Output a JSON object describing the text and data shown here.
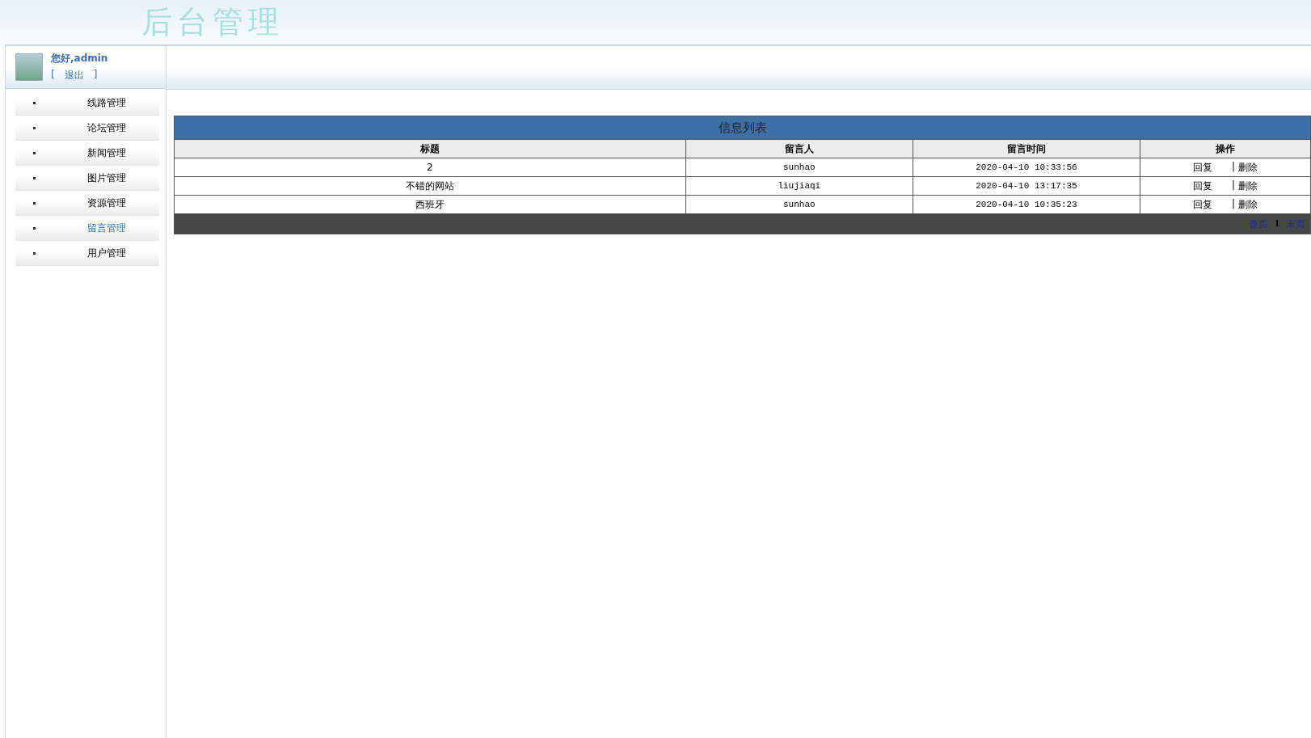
{
  "header": {
    "title": "后台管理"
  },
  "user": {
    "greeting": "您好,admin",
    "logout_open": "[",
    "logout": "退出",
    "logout_close": "]"
  },
  "sidebar": {
    "items": [
      {
        "label": "线路管理",
        "selected": false
      },
      {
        "label": "论坛管理",
        "selected": false
      },
      {
        "label": "新闻管理",
        "selected": false
      },
      {
        "label": "图片管理",
        "selected": false
      },
      {
        "label": "资源管理",
        "selected": false
      },
      {
        "label": "留言管理",
        "selected": true
      },
      {
        "label": "用户管理",
        "selected": false
      }
    ]
  },
  "table": {
    "title": "信息列表",
    "columns": [
      "标题",
      "留言人",
      "留言时间",
      "操作"
    ],
    "rows": [
      {
        "title": "2",
        "author": "sunhao",
        "time": "2020-04-10 10:33:56",
        "reply": "回复",
        "separator": "|",
        "delete": "删除"
      },
      {
        "title": "不错的网站",
        "author": "liujiaqi",
        "time": "2020-04-10 13:17:35",
        "reply": "回复",
        "separator": "|",
        "delete": "删除"
      },
      {
        "title": "西班牙",
        "author": "sunhao",
        "time": "2020-04-10 10:35:23",
        "reply": "回复",
        "separator": "|",
        "delete": "删除"
      }
    ],
    "pagination": {
      "first": "首页",
      "current": "1",
      "last": "末页"
    }
  }
}
